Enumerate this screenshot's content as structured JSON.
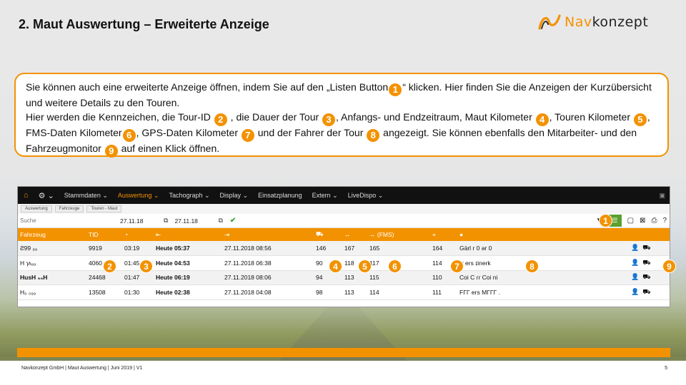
{
  "title": "2. Maut Auswertung – Erweiterte Anzeige",
  "logo": {
    "prefix": "Nav",
    "suffix": "konzept"
  },
  "info": {
    "p1": "Sie können auch eine erweiterte Anzeige öffnen, indem Sie auf den „Listen Button",
    "p2": "“ klicken. Hier finden Sie die Anzeigen der Kurzübersicht und weitere Details zu den Touren.",
    "p3": "Hier werden die Kennzeichen, die Tour-ID",
    "p4": ", die Dauer der Tour",
    "p5": ", Anfangs- und Endzeitraum, Maut Kilometer",
    "p6": ", Touren Kilometer",
    "p7": ", FMS-Daten Kilometer",
    "p8": ", GPS-Daten Kilometer",
    "p9": "und der Fahrer der Tour",
    "p10": "angezeigt. Sie können ebenfalls den Mitarbeiter-  und den Fahrzeugmonitor",
    "p11": "auf einen Klick öffnen.",
    "n1": "1",
    "n2": "2",
    "n3": "3",
    "n4": "4",
    "n5": "5",
    "n6": "6",
    "n7": "7",
    "n8": "8",
    "n9": "9"
  },
  "nav": {
    "items": [
      "Stammdaten ⌄",
      "Auswertung ⌄",
      "Tachograph ⌄",
      "Display ⌄",
      "Einsatzplanung",
      "Extern ⌄",
      "LiveDispo ⌄"
    ]
  },
  "breadcrumb": [
    "Auswertung",
    "Fahrzeuge",
    "Touren - Maut"
  ],
  "filter": {
    "search_placeholder": "Suche",
    "date_from": "27.11.18",
    "date_to": "27.11.18"
  },
  "table": {
    "headers": [
      "Fahrzeug",
      "TID",
      "",
      "",
      "",
      "",
      "",
      "(FMS)",
      "",
      ""
    ],
    "rows": [
      [
        "Ƨ99 ₉₉",
        "9919",
        "03:19",
        "Heute 05:37",
        "27.11.2018 08:56",
        "146",
        "167",
        "165",
        "164",
        "Gärl   r  0  ər 0"
      ],
      [
        "H ɿʌ₉₉",
        "4060",
        "01:45",
        "Heute 04:53",
        "27.11.2018 06:38",
        "90",
        "118",
        "117",
        "114",
        "ɾɾ  ers  ɪinerk"
      ],
      [
        "HusH ₉₉H",
        "24468",
        "01:47",
        "Heute 06:19",
        "27.11.2018 08:06",
        "94",
        "113",
        "115",
        "110",
        "Coi    C ɾɾ     Coi  ni"
      ],
      [
        "H₀ ₀₉₉",
        "13508",
        "01:30",
        "Heute 02:38",
        "27.11.2018 04:08",
        "98",
        "113",
        "114",
        "111",
        "FΓΓ    ers  MΓΓΓ   ."
      ]
    ]
  },
  "badges": [
    "1",
    "2",
    "3",
    "4",
    "5",
    "6",
    "7",
    "8",
    "9"
  ],
  "footer": {
    "text": "Navkonzept GmbH  |  Maut Auswertung  |  Juni 2019  |  V1",
    "page": "5"
  },
  "colors": {
    "accent": "#f39200",
    "list_button": "#5aa02c"
  }
}
